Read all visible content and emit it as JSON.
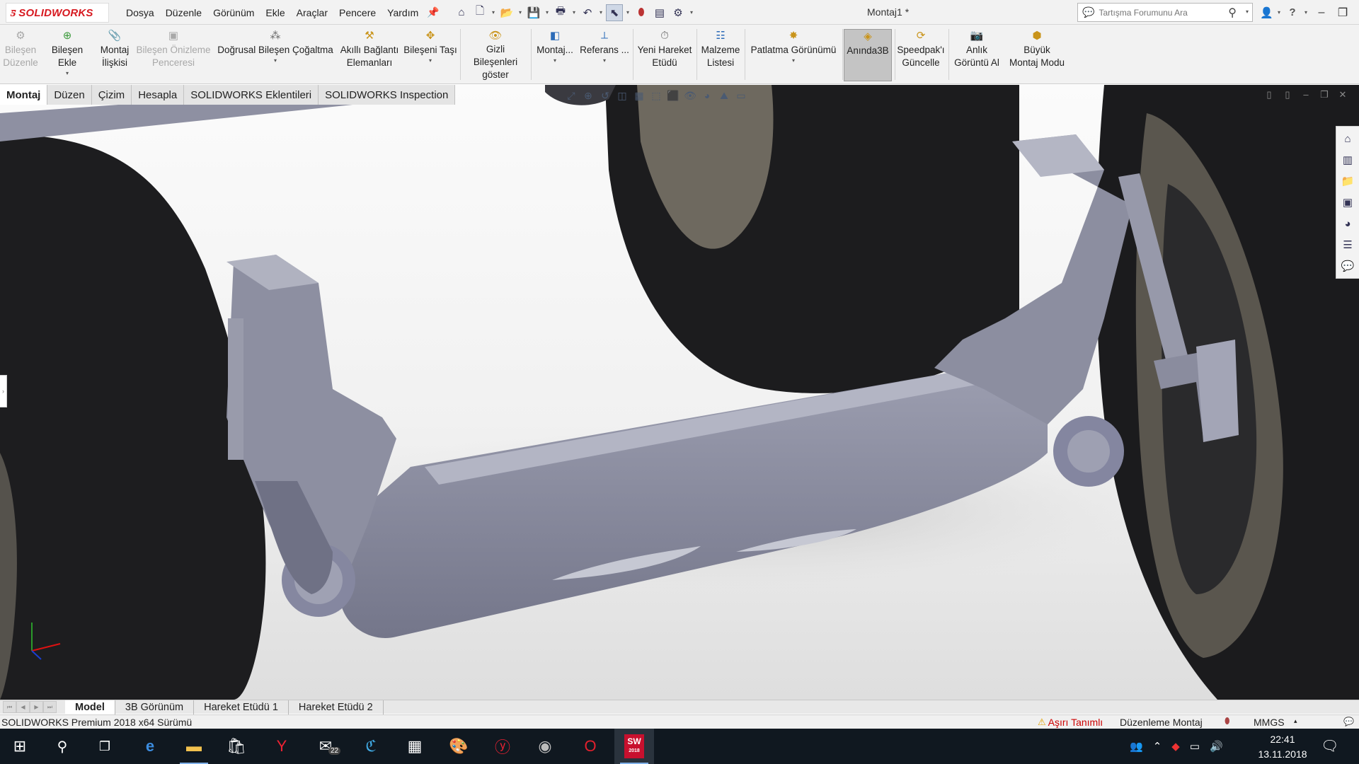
{
  "app": {
    "logo_text": "SOLIDWORKS",
    "document_title": "Montaj1 *",
    "brand_color": "#d71920"
  },
  "menu": [
    "Dosya",
    "Düzenle",
    "Görünüm",
    "Ekle",
    "Araçlar",
    "Pencere",
    "Yardım"
  ],
  "search": {
    "placeholder": "Tartışma Forumunu Ara"
  },
  "ribbon": {
    "edit_component": [
      "Bileşen",
      "Düzenle"
    ],
    "insert_component": "Bileşen Ekle",
    "mate": [
      "Montaj",
      "İlişkisi"
    ],
    "component_preview": [
      "Bileşen Önizleme",
      "Penceresi"
    ],
    "linear_pattern": "Doğrusal Bileşen Çoğaltma",
    "smart_fasteners": [
      "Akıllı Bağlantı",
      "Elemanları"
    ],
    "move_component": "Bileşeni Taşı",
    "show_hidden": [
      "Gizli Bileşenleri",
      "göster"
    ],
    "assembly_features": "Montaj...",
    "reference_geometry": "Referans ...",
    "new_motion_study": [
      "Yeni Hareket",
      "Etüdü"
    ],
    "bill_of_materials": [
      "Malzeme",
      "Listesi"
    ],
    "exploded_view": "Patlatma Görünümü",
    "instant3d": "Anında3B",
    "update_speedpak": [
      "Speedpak'ı",
      "Güncelle"
    ],
    "take_snapshot": [
      "Anlık",
      "Görüntü Al"
    ],
    "large_assembly_mode": [
      "Büyük",
      "Montaj Modu"
    ]
  },
  "command_tabs": [
    "Montaj",
    "Düzen",
    "Çizim",
    "Hesapla",
    "SOLIDWORKS Eklentileri",
    "SOLIDWORKS Inspection"
  ],
  "bottom_tabs": [
    "Model",
    "3B Görünüm",
    "Hareket Etüdü 1",
    "Hareket Etüdü 2"
  ],
  "status": {
    "version": "SOLIDWORKS Premium 2018 x64 Sürümü",
    "warning": "Aşırı Tanımlı",
    "mode": "Düzenleme Montaj",
    "units": "MMGS"
  },
  "taskbar": {
    "mail_badge": "22",
    "time": "22:41",
    "date": "13.11.2018",
    "sw_label": "2018"
  },
  "icons": {
    "logo": "ds-logo-icon",
    "search": "search-icon",
    "windows": "windows-start-icon"
  }
}
